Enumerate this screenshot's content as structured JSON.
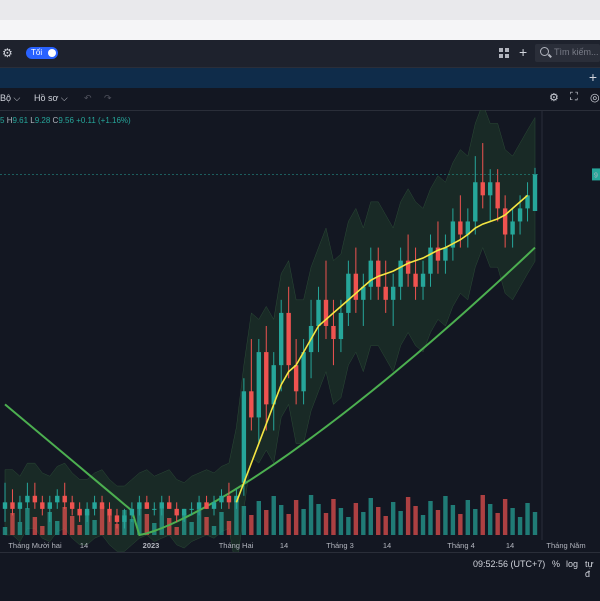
{
  "header": {
    "theme_toggle_label": "Tối",
    "search_placeholder": "Tìm kiếm..."
  },
  "toolbar": {
    "interval_label": "Bộ",
    "profile_label": "Hồ sơ"
  },
  "legend": {
    "h_label": "H",
    "h_value": "9.61",
    "l_label": "L",
    "l_value": "9.28",
    "c_label": "C",
    "c_value": "9.56",
    "change": "+0.11 (+1.16%)",
    "prefix": "5"
  },
  "axis": {
    "x_ticks": [
      "Tháng Mười hai",
      "14",
      "2023",
      "Tháng Hai",
      "14",
      "Tháng 3",
      "14",
      "Tháng 4",
      "14",
      "Tháng Năm"
    ],
    "price_badge": "9"
  },
  "status": {
    "time": "09:52:56 (UTC+7)",
    "percent_label": "%",
    "log_label": "log",
    "auto_label": "tự đ"
  },
  "colors": {
    "up": "#26a69a",
    "down": "#ef5350",
    "ma_yellow": "#f5e642",
    "ma_green": "#4caf50",
    "band_fill": "#1f3a2a"
  },
  "chart_data": {
    "type": "candlestick",
    "x": [
      "Dec",
      "Dec-14",
      "Jan-2023",
      "Feb",
      "Feb-14",
      "Mar",
      "Mar-14",
      "Apr",
      "Apr-14",
      "May"
    ],
    "candles": [
      {
        "o": 7.0,
        "h": 7.2,
        "l": 6.9,
        "c": 7.05
      },
      {
        "o": 7.05,
        "h": 7.15,
        "l": 6.95,
        "c": 7.0
      },
      {
        "o": 7.0,
        "h": 7.1,
        "l": 6.9,
        "c": 7.05
      },
      {
        "o": 7.05,
        "h": 7.2,
        "l": 7.0,
        "c": 7.1
      },
      {
        "o": 7.1,
        "h": 7.2,
        "l": 7.0,
        "c": 7.05
      },
      {
        "o": 7.05,
        "h": 7.1,
        "l": 6.95,
        "c": 7.0
      },
      {
        "o": 7.0,
        "h": 7.1,
        "l": 6.9,
        "c": 7.05
      },
      {
        "o": 7.05,
        "h": 7.15,
        "l": 7.0,
        "c": 7.1
      },
      {
        "o": 7.1,
        "h": 7.2,
        "l": 7.0,
        "c": 7.05
      },
      {
        "o": 7.05,
        "h": 7.1,
        "l": 6.95,
        "c": 7.0
      },
      {
        "o": 7.0,
        "h": 7.05,
        "l": 6.9,
        "c": 6.95
      },
      {
        "o": 6.95,
        "h": 7.05,
        "l": 6.9,
        "c": 7.0
      },
      {
        "o": 7.0,
        "h": 7.1,
        "l": 6.95,
        "c": 7.05
      },
      {
        "o": 7.05,
        "h": 7.1,
        "l": 7.0,
        "c": 7.0
      },
      {
        "o": 7.0,
        "h": 7.05,
        "l": 6.9,
        "c": 6.95
      },
      {
        "o": 6.95,
        "h": 7.0,
        "l": 6.85,
        "c": 6.9
      },
      {
        "o": 6.9,
        "h": 7.0,
        "l": 6.85,
        "c": 6.95
      },
      {
        "o": 6.95,
        "h": 7.05,
        "l": 6.9,
        "c": 7.0
      },
      {
        "o": 7.0,
        "h": 7.1,
        "l": 6.95,
        "c": 7.05
      },
      {
        "o": 7.05,
        "h": 7.1,
        "l": 7.0,
        "c": 7.0
      },
      {
        "o": 7.0,
        "h": 7.05,
        "l": 6.95,
        "c": 7.0
      },
      {
        "o": 7.0,
        "h": 7.1,
        "l": 6.95,
        "c": 7.05
      },
      {
        "o": 7.05,
        "h": 7.1,
        "l": 7.0,
        "c": 7.0
      },
      {
        "o": 7.0,
        "h": 7.05,
        "l": 6.9,
        "c": 6.95
      },
      {
        "o": 6.95,
        "h": 7.0,
        "l": 6.9,
        "c": 7.0
      },
      {
        "o": 7.0,
        "h": 7.05,
        "l": 6.95,
        "c": 7.0
      },
      {
        "o": 7.0,
        "h": 7.1,
        "l": 6.95,
        "c": 7.05
      },
      {
        "o": 7.05,
        "h": 7.1,
        "l": 7.0,
        "c": 7.0
      },
      {
        "o": 7.0,
        "h": 7.1,
        "l": 6.95,
        "c": 7.05
      },
      {
        "o": 7.05,
        "h": 7.15,
        "l": 7.0,
        "c": 7.1
      },
      {
        "o": 7.1,
        "h": 7.2,
        "l": 7.0,
        "c": 7.05
      },
      {
        "o": 7.05,
        "h": 7.15,
        "l": 7.0,
        "c": 7.1
      },
      {
        "o": 7.2,
        "h": 8.0,
        "l": 7.1,
        "c": 7.9
      },
      {
        "o": 7.9,
        "h": 8.3,
        "l": 7.6,
        "c": 7.7
      },
      {
        "o": 7.7,
        "h": 8.3,
        "l": 7.5,
        "c": 8.2
      },
      {
        "o": 8.2,
        "h": 8.4,
        "l": 7.6,
        "c": 7.8
      },
      {
        "o": 7.8,
        "h": 8.2,
        "l": 7.6,
        "c": 8.1
      },
      {
        "o": 8.1,
        "h": 8.6,
        "l": 7.9,
        "c": 8.5
      },
      {
        "o": 8.5,
        "h": 8.7,
        "l": 8.0,
        "c": 8.1
      },
      {
        "o": 8.1,
        "h": 8.3,
        "l": 7.8,
        "c": 7.9
      },
      {
        "o": 7.9,
        "h": 8.3,
        "l": 7.8,
        "c": 8.2
      },
      {
        "o": 8.2,
        "h": 8.6,
        "l": 8.0,
        "c": 8.4
      },
      {
        "o": 8.4,
        "h": 8.7,
        "l": 8.2,
        "c": 8.6
      },
      {
        "o": 8.6,
        "h": 8.9,
        "l": 8.3,
        "c": 8.4
      },
      {
        "o": 8.4,
        "h": 8.6,
        "l": 8.1,
        "c": 8.3
      },
      {
        "o": 8.3,
        "h": 8.6,
        "l": 8.2,
        "c": 8.5
      },
      {
        "o": 8.5,
        "h": 8.9,
        "l": 8.4,
        "c": 8.8
      },
      {
        "o": 8.8,
        "h": 9.0,
        "l": 8.5,
        "c": 8.6
      },
      {
        "o": 8.6,
        "h": 8.8,
        "l": 8.4,
        "c": 8.7
      },
      {
        "o": 8.7,
        "h": 9.0,
        "l": 8.6,
        "c": 8.9
      },
      {
        "o": 8.9,
        "h": 9.0,
        "l": 8.6,
        "c": 8.7
      },
      {
        "o": 8.7,
        "h": 8.9,
        "l": 8.5,
        "c": 8.6
      },
      {
        "o": 8.6,
        "h": 8.8,
        "l": 8.4,
        "c": 8.7
      },
      {
        "o": 8.7,
        "h": 9.0,
        "l": 8.6,
        "c": 8.9
      },
      {
        "o": 8.9,
        "h": 9.1,
        "l": 8.7,
        "c": 8.8
      },
      {
        "o": 8.8,
        "h": 9.0,
        "l": 8.6,
        "c": 8.7
      },
      {
        "o": 8.7,
        "h": 8.9,
        "l": 8.6,
        "c": 8.8
      },
      {
        "o": 8.8,
        "h": 9.1,
        "l": 8.7,
        "c": 9.0
      },
      {
        "o": 9.0,
        "h": 9.2,
        "l": 8.8,
        "c": 8.9
      },
      {
        "o": 8.9,
        "h": 9.1,
        "l": 8.8,
        "c": 9.0
      },
      {
        "o": 9.0,
        "h": 9.3,
        "l": 8.9,
        "c": 9.2
      },
      {
        "o": 9.2,
        "h": 9.4,
        "l": 9.0,
        "c": 9.1
      },
      {
        "o": 9.1,
        "h": 9.3,
        "l": 9.0,
        "c": 9.2
      },
      {
        "o": 9.2,
        "h": 9.7,
        "l": 9.1,
        "c": 9.5
      },
      {
        "o": 9.5,
        "h": 9.8,
        "l": 9.3,
        "c": 9.4
      },
      {
        "o": 9.4,
        "h": 9.6,
        "l": 9.2,
        "c": 9.5
      },
      {
        "o": 9.5,
        "h": 9.6,
        "l": 9.2,
        "c": 9.3
      },
      {
        "o": 9.3,
        "h": 9.4,
        "l": 9.0,
        "c": 9.1
      },
      {
        "o": 9.1,
        "h": 9.3,
        "l": 9.0,
        "c": 9.2
      },
      {
        "o": 9.2,
        "h": 9.4,
        "l": 9.1,
        "c": 9.3
      },
      {
        "o": 9.3,
        "h": 9.5,
        "l": 9.2,
        "c": 9.4
      },
      {
        "o": 9.28,
        "h": 9.61,
        "l": 9.28,
        "c": 9.56
      }
    ],
    "ma_yellow": [
      null,
      null,
      null,
      null,
      null,
      null,
      null,
      null,
      null,
      null,
      null,
      null,
      null,
      null,
      null,
      null,
      null,
      null,
      null,
      null,
      null,
      null,
      null,
      null,
      null,
      null,
      null,
      null,
      null,
      null,
      null,
      7.05,
      7.2,
      7.35,
      7.5,
      7.65,
      7.8,
      7.95,
      8.05,
      8.1,
      8.2,
      8.3,
      8.4,
      8.45,
      8.5,
      8.55,
      8.6,
      8.65,
      8.7,
      8.75,
      8.78,
      8.8,
      8.82,
      8.85,
      8.88,
      8.9,
      8.92,
      8.95,
      8.98,
      9.0,
      9.03,
      9.06,
      9.1,
      9.15,
      9.18,
      9.2,
      9.22,
      9.25,
      9.3,
      9.35,
      9.4
    ],
    "ma_green_start": 7.8,
    "ylim": [
      6.8,
      9.9
    ]
  }
}
